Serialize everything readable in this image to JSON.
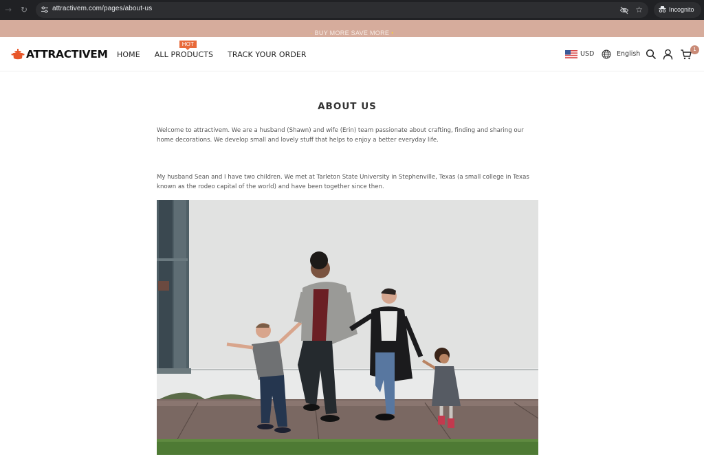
{
  "browser": {
    "url": "attractivem.com/pages/about-us",
    "profile_label": "Incognito",
    "icons": [
      "back-icon",
      "reload-icon",
      "site-settings-icon",
      "eye-off-icon",
      "star-icon",
      "incognito-icon"
    ]
  },
  "announcement": {
    "text": "BUY MORE SAVE MORE",
    "accent_color": "#f2c94c",
    "background_color": "#d6ac9c"
  },
  "header": {
    "logo_text": "ATTRACTIVEM",
    "brand_color": "#e8572a",
    "nav": [
      {
        "label": "HOME"
      },
      {
        "label": "ALL PRODUCTS",
        "badge": "HOT"
      },
      {
        "label": "TRACK YOUR ORDER"
      }
    ],
    "currency": "USD",
    "language": "English",
    "cart_count": "1",
    "icons": [
      "us-flag-icon",
      "globe-icon",
      "search-icon",
      "user-icon",
      "cart-icon"
    ]
  },
  "main": {
    "title": "ABOUT US",
    "paragraphs": [
      "Welcome to attractivem. We are a husband (Shawn) and wife (Erin) team passionate about crafting, finding and sharing our home decorations. We develop small and lovely stuff that helps to enjoy a better everyday life.",
      "My husband Sean and I have two children. We met at Tarleton State University in Stephenville, Texas (a small college in Texas known as the rodeo capital of the world) and have been together since then."
    ],
    "image_alt": "Family of four holding hands walking along a sidewalk in front of a white wall"
  }
}
